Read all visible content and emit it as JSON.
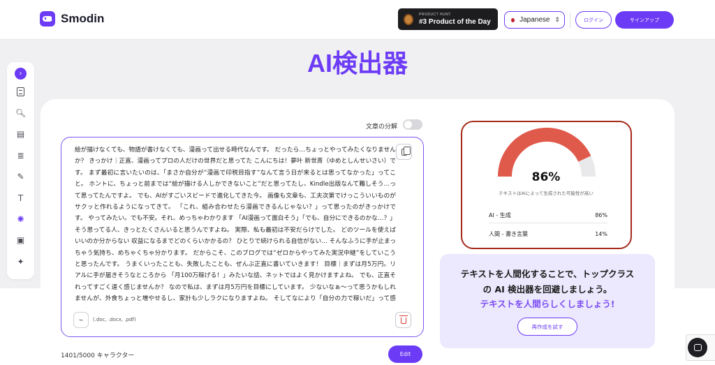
{
  "header": {
    "brand": "Smodin",
    "product_hunt": {
      "small": "PRODUCT HUNT",
      "main": "#3 Product of the Day"
    },
    "language": "Japanese",
    "login_label": "ログイン",
    "signup_label": "サインアップ"
  },
  "page_title": "AI検出器",
  "toggle": {
    "label": "文章の分解",
    "on": false
  },
  "editor": {
    "text": "絵が描けなくても、物語が書けなくても、漫画って出せる時代なんです。 だったら…ちょっとやってみたくなりませんか？ きっかけ｜正直、漫画ってプロの人だけの世界だと思ってた こんにちは！夢叶 新世斎（ゆめとしんせいさい）です。 まず最初に言いたいのは、「まさか自分が“漫画で印税目指す”なんて言う日が来るとは思ってなかった」ってこと。 ホントに、ちょっと前までは“絵が描ける人しかできないこと”だと思ってたし、Kindle出版なんて難しそう…って思ってたんですよ。 でも、AIがすごいスピードで進化してきた今。 画像も文章も、工夫次第でけっこういいものがサクッと作れるようになってきて。 「これ、組み合わせたら漫画できるんじゃない？」って思ったのがきっかけです。 やってみたい。でも不安。それ、めっちゃわかります 「AI漫画って面白そう」「でも、自分にできるのかな…？」 そう思ってる人、きっとたくさんいると思うんですよね。 実際、私も最初は不安だらけでした。 どのツールを使えばいいのか分からない 収益になるまでどのくらいかかるの？ ひとりで続けられる自信がない… そんなふうに手が止まっちゃう気持ち、めちゃくちゃ分かります。 だからこそ、このブログでは“ゼロからやってみた実況中継”をしていこうと思ったんです。 うまくいったことも、失敗したことも、ぜんぶ正直に書いていきます！ 目標｜まずは月5万円。リアルに手が届きそうなところから 「月100万稼げる！」みたいな話、ネットではよく見かけますよね。 でも、正直それってすごく遠く感じませんか？ なので私は、まずは月5万円を目標にしています。 少ないなぁ〜って思うかもしれませんが、外食ちょっと増やせるし、家計も少しラクになりますよね。 そしてなにより「自分の力で稼いだ」って感覚がめちゃくちゃ嬉しいと思うんです。 もちろん最初からうまくいくとは思ってません。 でも毎月ちょっとずつ作品を出して、コツコツ育てていけたら、きっと現実になってくるはず。 そして気づいた時には、５万円は最低な通過点になっているでしょう。",
    "attach_hint": "(.doc, .docx, .pdf)",
    "char_count": "1401/5000 キャラクター",
    "edit_label": "Edit"
  },
  "result": {
    "ai_percent": 86,
    "percent_label": "86%",
    "caption": "テキストはAIによって生成された可能性が高い",
    "rows": [
      {
        "label": "AI - 生成",
        "value": "86%"
      },
      {
        "label": "人間 - 書き言葉",
        "value": "14%"
      }
    ],
    "colors": {
      "ai": "#e05a4c",
      "human": "#e9e9ec",
      "border": "#a52a1c"
    }
  },
  "humanize": {
    "line1": "テキストを人間化することで、トップクラス",
    "line2": "の AI 検出器を回避しましょう。",
    "line3": "テキストを人間らしくしましょう!",
    "retry_label": "再作成を試す"
  },
  "sidebar": {
    "icons": [
      "chevron-right-icon",
      "document-icon",
      "document-search-icon",
      "notes-icon",
      "summary-icon",
      "pen-icon",
      "text-icon",
      "palette-icon",
      "file-icon",
      "magic-wand-icon"
    ]
  },
  "accent": "#6c3bf5"
}
